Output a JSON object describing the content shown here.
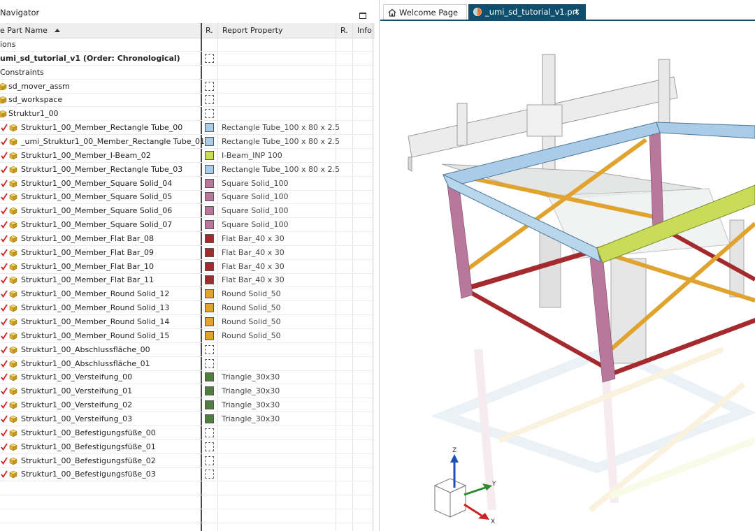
{
  "navigator": {
    "title": "Navigator",
    "columns": {
      "name": "e Part Name",
      "r1": "R.",
      "report": "Report Property",
      "r2": "R.",
      "info": "Info"
    },
    "rows": [
      {
        "name": "ions",
        "indent": 0,
        "check": false,
        "icon": "none",
        "swatch": "none",
        "prop": "",
        "bold": false
      },
      {
        "name": "umi_sd_tutorial_v1 (Order: Chronological)",
        "indent": 0,
        "check": false,
        "icon": "none",
        "swatch": "empty",
        "prop": "",
        "bold": true
      },
      {
        "name": "Constraints",
        "indent": 0,
        "check": false,
        "icon": "none",
        "swatch": "none",
        "prop": "",
        "bold": false
      },
      {
        "name": "sd_mover_assm",
        "indent": 1,
        "check": false,
        "icon": "assembly",
        "swatch": "empty",
        "prop": "",
        "bold": false
      },
      {
        "name": "sd_workspace",
        "indent": 1,
        "check": false,
        "icon": "assembly",
        "swatch": "empty",
        "prop": "",
        "bold": false
      },
      {
        "name": "Struktur1_00",
        "indent": 1,
        "check": false,
        "icon": "assembly",
        "swatch": "empty",
        "prop": "",
        "bold": false
      },
      {
        "name": "Struktur1_00_Member_Rectangle Tube_00",
        "indent": 2,
        "check": true,
        "icon": "part",
        "swatch": "#a9cce8",
        "prop": "Rectangle Tube_100 x 80 x 2.5",
        "bold": false
      },
      {
        "name": "_umi_Struktur1_00_Member_Rectangle Tube_01",
        "indent": 2,
        "check": true,
        "icon": "part",
        "swatch": "#a9cce8",
        "prop": "Rectangle Tube_100 x 80 x 2.5",
        "bold": false
      },
      {
        "name": "Struktur1_00_Member_I-Beam_02",
        "indent": 2,
        "check": true,
        "icon": "part",
        "swatch": "#c9dc5a",
        "prop": "I-Beam_INP 100",
        "bold": false
      },
      {
        "name": "Struktur1_00_Member_Rectangle Tube_03",
        "indent": 2,
        "check": true,
        "icon": "part",
        "swatch": "#a9cce8",
        "prop": "Rectangle Tube_100 x 80 x 2.5",
        "bold": false
      },
      {
        "name": "Struktur1_00_Member_Square Solid_04",
        "indent": 2,
        "check": true,
        "icon": "part",
        "swatch": "#b9779b",
        "prop": "Square Solid_100",
        "bold": false
      },
      {
        "name": "Struktur1_00_Member_Square Solid_05",
        "indent": 2,
        "check": true,
        "icon": "part",
        "swatch": "#b9779b",
        "prop": "Square Solid_100",
        "bold": false
      },
      {
        "name": "Struktur1_00_Member_Square Solid_06",
        "indent": 2,
        "check": true,
        "icon": "part",
        "swatch": "#b9779b",
        "prop": "Square Solid_100",
        "bold": false
      },
      {
        "name": "Struktur1_00_Member_Square Solid_07",
        "indent": 2,
        "check": true,
        "icon": "part",
        "swatch": "#b9779b",
        "prop": "Square Solid_100",
        "bold": false
      },
      {
        "name": "Struktur1_00_Member_Flat Bar_08",
        "indent": 2,
        "check": true,
        "icon": "part",
        "swatch": "#a42a2e",
        "prop": "Flat Bar_40 x 30",
        "bold": false
      },
      {
        "name": "Struktur1_00_Member_Flat Bar_09",
        "indent": 2,
        "check": true,
        "icon": "part",
        "swatch": "#a42a2e",
        "prop": "Flat Bar_40 x 30",
        "bold": false
      },
      {
        "name": "Struktur1_00_Member_Flat Bar_10",
        "indent": 2,
        "check": true,
        "icon": "part",
        "swatch": "#a42a2e",
        "prop": "Flat Bar_40 x 30",
        "bold": false
      },
      {
        "name": "Struktur1_00_Member_Flat Bar_11",
        "indent": 2,
        "check": true,
        "icon": "part",
        "swatch": "#a42a2e",
        "prop": "Flat Bar_40 x 30",
        "bold": false
      },
      {
        "name": "Struktur1_00_Member_Round Solid_12",
        "indent": 2,
        "check": true,
        "icon": "part",
        "swatch": "#e0a32e",
        "prop": "Round Solid_50",
        "bold": false
      },
      {
        "name": "Struktur1_00_Member_Round Solid_13",
        "indent": 2,
        "check": true,
        "icon": "part",
        "swatch": "#e0a32e",
        "prop": "Round Solid_50",
        "bold": false
      },
      {
        "name": "Struktur1_00_Member_Round Solid_14",
        "indent": 2,
        "check": true,
        "icon": "part",
        "swatch": "#e0a32e",
        "prop": "Round Solid_50",
        "bold": false
      },
      {
        "name": "Struktur1_00_Member_Round Solid_15",
        "indent": 2,
        "check": true,
        "icon": "part",
        "swatch": "#e0a32e",
        "prop": "Round Solid_50",
        "bold": false
      },
      {
        "name": "Struktur1_00_Abschlussfläche_00",
        "indent": 2,
        "check": true,
        "icon": "part",
        "swatch": "empty",
        "prop": "",
        "bold": false
      },
      {
        "name": "Struktur1_00_Abschlussfläche_01",
        "indent": 2,
        "check": true,
        "icon": "part",
        "swatch": "empty",
        "prop": "",
        "bold": false
      },
      {
        "name": "Struktur1_00_Versteifung_00",
        "indent": 2,
        "check": true,
        "icon": "part",
        "swatch": "#4f7f3e",
        "prop": "Triangle_30x30",
        "bold": false
      },
      {
        "name": "Struktur1_00_Versteifung_01",
        "indent": 2,
        "check": true,
        "icon": "part",
        "swatch": "#4f7f3e",
        "prop": "Triangle_30x30",
        "bold": false
      },
      {
        "name": "Struktur1_00_Versteifung_02",
        "indent": 2,
        "check": true,
        "icon": "part",
        "swatch": "#4f7f3e",
        "prop": "Triangle_30x30",
        "bold": false
      },
      {
        "name": "Struktur1_00_Versteifung_03",
        "indent": 2,
        "check": true,
        "icon": "part",
        "swatch": "#4f7f3e",
        "prop": "Triangle_30x30",
        "bold": false
      },
      {
        "name": "Struktur1_00_Befestigungsfüße_00",
        "indent": 2,
        "check": true,
        "icon": "part",
        "swatch": "empty",
        "prop": "",
        "bold": false
      },
      {
        "name": "Struktur1_00_Befestigungsfüße_01",
        "indent": 2,
        "check": true,
        "icon": "part",
        "swatch": "empty",
        "prop": "",
        "bold": false
      },
      {
        "name": "Struktur1_00_Befestigungsfüße_02",
        "indent": 2,
        "check": true,
        "icon": "part",
        "swatch": "empty",
        "prop": "",
        "bold": false
      },
      {
        "name": "Struktur1_00_Befestigungsfüße_03",
        "indent": 2,
        "check": true,
        "icon": "part",
        "swatch": "empty",
        "prop": "",
        "bold": false
      }
    ]
  },
  "viewer": {
    "tabs": [
      {
        "label": "Welcome Page",
        "icon": "home-icon",
        "active": false
      },
      {
        "label": "_umi_sd_tutorial_v1.prt",
        "icon": "part-file-icon",
        "active": true
      }
    ],
    "close_glyph": "✕",
    "triad": {
      "x": "X",
      "y": "Y",
      "z": "Z"
    }
  },
  "colors": {
    "tab_active": "#0e4f6e",
    "rect_tube": "#a9cce8",
    "i_beam": "#c9dc5a",
    "square_solid": "#b9779b",
    "flat_bar": "#a42a2e",
    "round_solid": "#e0a32e",
    "triangle": "#4f7f3e",
    "check": "#d32020"
  }
}
